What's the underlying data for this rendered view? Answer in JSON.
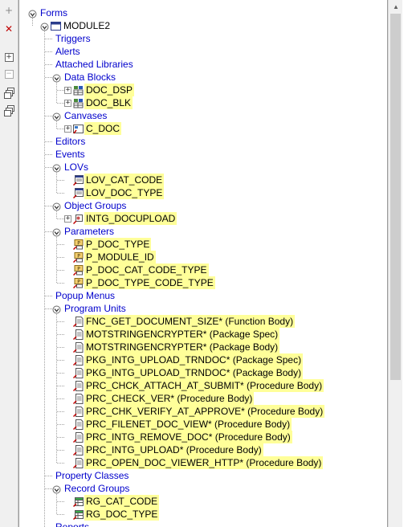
{
  "toolbar": {
    "buttons": [
      {
        "name": "create-button",
        "icon": "plus-icon",
        "glyph": "+"
      },
      {
        "name": "delete-button",
        "icon": "x-icon",
        "glyph": "✕"
      },
      {
        "name": "expand-button",
        "icon": "expand-icon",
        "glyph": "+"
      },
      {
        "name": "collapse-button",
        "icon": "collapse-icon",
        "glyph": "−"
      },
      {
        "name": "expand-all-button",
        "icon": "expand-all-icon",
        "glyph": "+"
      },
      {
        "name": "collapse-all-button",
        "icon": "collapse-all-icon",
        "glyph": "−"
      }
    ]
  },
  "tree": {
    "root": "Forms",
    "module": "MODULE2",
    "nodes": [
      {
        "label": "Triggers",
        "level": 2,
        "expander": "none",
        "highlight": false,
        "icon": ""
      },
      {
        "label": "Alerts",
        "level": 2,
        "expander": "none",
        "highlight": false,
        "icon": ""
      },
      {
        "label": "Attached Libraries",
        "level": 2,
        "expander": "none",
        "highlight": false,
        "icon": ""
      },
      {
        "label": "Data Blocks",
        "level": 2,
        "expander": "down",
        "highlight": false,
        "icon": ""
      },
      {
        "label": "DOC_DSP",
        "level": 3,
        "expander": "plus",
        "highlight": true,
        "icon": "block-icon"
      },
      {
        "label": "DOC_BLK",
        "level": 3,
        "expander": "plus",
        "highlight": true,
        "icon": "block-icon"
      },
      {
        "label": "Canvases",
        "level": 2,
        "expander": "down",
        "highlight": false,
        "icon": ""
      },
      {
        "label": "C_DOC",
        "level": 3,
        "expander": "plus",
        "highlight": true,
        "icon": "canvas-icon"
      },
      {
        "label": "Editors",
        "level": 2,
        "expander": "none",
        "highlight": false,
        "icon": ""
      },
      {
        "label": "Events",
        "level": 2,
        "expander": "none",
        "highlight": false,
        "icon": ""
      },
      {
        "label": "LOVs",
        "level": 2,
        "expander": "down",
        "highlight": false,
        "icon": ""
      },
      {
        "label": "LOV_CAT_CODE",
        "level": 3,
        "expander": "none",
        "highlight": true,
        "icon": "lov-icon"
      },
      {
        "label": "LOV_DOC_TYPE",
        "level": 3,
        "expander": "none",
        "highlight": true,
        "icon": "lov-icon"
      },
      {
        "label": "Object Groups",
        "level": 2,
        "expander": "down",
        "highlight": false,
        "icon": ""
      },
      {
        "label": "INTG_DOCUPLOAD",
        "level": 3,
        "expander": "plus",
        "highlight": true,
        "icon": "object-group-icon"
      },
      {
        "label": "Parameters",
        "level": 2,
        "expander": "down",
        "highlight": false,
        "icon": ""
      },
      {
        "label": "P_DOC_TYPE",
        "level": 3,
        "expander": "none",
        "highlight": true,
        "icon": "parameter-icon"
      },
      {
        "label": "P_MODULE_ID",
        "level": 3,
        "expander": "none",
        "highlight": true,
        "icon": "parameter-icon"
      },
      {
        "label": "P_DOC_CAT_CODE_TYPE",
        "level": 3,
        "expander": "none",
        "highlight": true,
        "icon": "parameter-icon"
      },
      {
        "label": "P_DOC_TYPE_CODE_TYPE",
        "level": 3,
        "expander": "none",
        "highlight": true,
        "icon": "parameter-icon"
      },
      {
        "label": "Popup Menus",
        "level": 2,
        "expander": "none",
        "highlight": false,
        "icon": ""
      },
      {
        "label": "Program Units",
        "level": 2,
        "expander": "down",
        "highlight": false,
        "icon": ""
      },
      {
        "label": "FNC_GET_DOCUMENT_SIZE* (Function Body)",
        "level": 3,
        "expander": "none",
        "highlight": true,
        "icon": "program-unit-icon"
      },
      {
        "label": "MOTSTRINGENCRYPTER* (Package Spec)",
        "level": 3,
        "expander": "none",
        "highlight": true,
        "icon": "program-unit-icon"
      },
      {
        "label": "MOTSTRINGENCRYPTER* (Package Body)",
        "level": 3,
        "expander": "none",
        "highlight": true,
        "icon": "program-unit-icon"
      },
      {
        "label": "PKG_INTG_UPLOAD_TRNDOC* (Package Spec)",
        "level": 3,
        "expander": "none",
        "highlight": true,
        "icon": "program-unit-icon"
      },
      {
        "label": "PKG_INTG_UPLOAD_TRNDOC* (Package Body)",
        "level": 3,
        "expander": "none",
        "highlight": true,
        "icon": "program-unit-icon"
      },
      {
        "label": "PRC_CHCK_ATTACH_AT_SUBMIT* (Procedure Body)",
        "level": 3,
        "expander": "none",
        "highlight": true,
        "icon": "program-unit-icon"
      },
      {
        "label": "PRC_CHECK_VER* (Procedure Body)",
        "level": 3,
        "expander": "none",
        "highlight": true,
        "icon": "program-unit-icon"
      },
      {
        "label": "PRC_CHK_VERIFY_AT_APPROVE* (Procedure Body)",
        "level": 3,
        "expander": "none",
        "highlight": true,
        "icon": "program-unit-icon"
      },
      {
        "label": "PRC_FILENET_DOC_VIEW* (Procedure Body)",
        "level": 3,
        "expander": "none",
        "highlight": true,
        "icon": "program-unit-icon"
      },
      {
        "label": "PRC_INTG_REMOVE_DOC* (Procedure Body)",
        "level": 3,
        "expander": "none",
        "highlight": true,
        "icon": "program-unit-icon"
      },
      {
        "label": "PRC_INTG_UPLOAD* (Procedure Body)",
        "level": 3,
        "expander": "none",
        "highlight": true,
        "icon": "program-unit-icon"
      },
      {
        "label": "PRC_OPEN_DOC_VIEWER_HTTP* (Procedure Body)",
        "level": 3,
        "expander": "none",
        "highlight": true,
        "icon": "program-unit-icon"
      },
      {
        "label": "Property Classes",
        "level": 2,
        "expander": "none",
        "highlight": false,
        "icon": ""
      },
      {
        "label": "Record Groups",
        "level": 2,
        "expander": "down",
        "highlight": false,
        "icon": ""
      },
      {
        "label": "RG_CAT_CODE",
        "level": 3,
        "expander": "none",
        "highlight": true,
        "icon": "record-group-icon"
      },
      {
        "label": "RG_DOC_TYPE",
        "level": 3,
        "expander": "none",
        "highlight": true,
        "icon": "record-group-icon"
      },
      {
        "label": "Reports",
        "level": 2,
        "expander": "none",
        "highlight": false,
        "icon": ""
      }
    ]
  },
  "colors": {
    "link": "#0000cc",
    "highlight": "#ffff99",
    "frame": "#9a9a9a"
  }
}
